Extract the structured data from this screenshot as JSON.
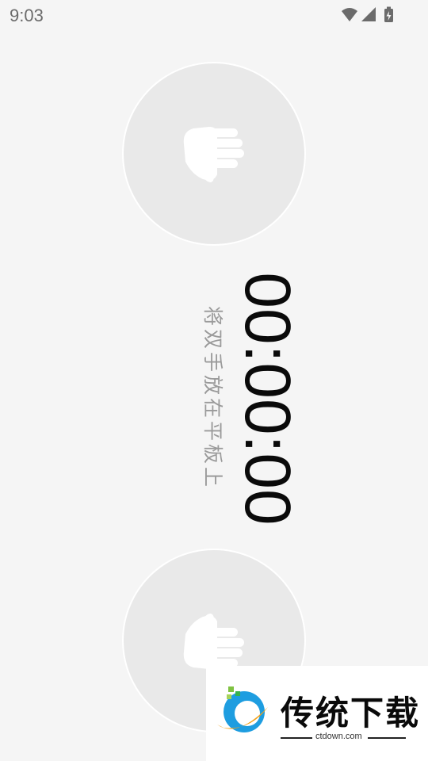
{
  "status_bar": {
    "time": "9:03",
    "icons": [
      "wifi-icon",
      "cell-signal-icon",
      "battery-charging-icon"
    ]
  },
  "timer": {
    "display": "00:00:00",
    "instruction": "将双手放在平板上"
  },
  "hand_pads": [
    {
      "icon": "hand-icon",
      "position": "top"
    },
    {
      "icon": "hand-icon",
      "position": "bottom"
    }
  ],
  "watermark": {
    "title": "传统下载",
    "url": "ctdown.com"
  },
  "colors": {
    "background": "#f5f5f5",
    "pad": "#e9e9e9",
    "hand": "#ffffff",
    "timer": "#0a0a0a",
    "instruction": "#9a9a9a"
  }
}
